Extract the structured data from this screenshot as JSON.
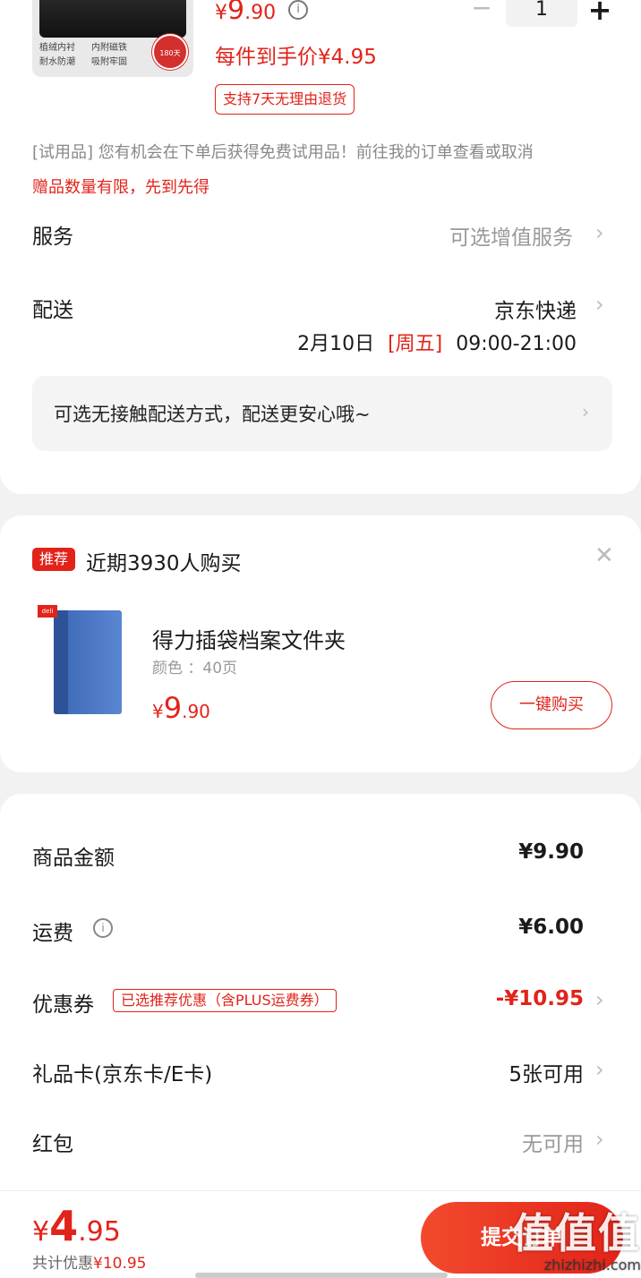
{
  "product": {
    "price_symbol": "¥",
    "price_int": "9",
    "price_dec": ".90",
    "tags": [
      "植绒内衬",
      "内附磁铁",
      "耐水防潮",
      "吸附牢固"
    ],
    "badge_text": "180天",
    "unit_price_text": "每件到手价¥4.95",
    "return_tag": "支持7天无理由退货",
    "quantity": "1",
    "qty_minus": "−",
    "qty_plus": "+"
  },
  "trial": {
    "text": "[试用品] 您有机会在下单后获得免费试用品！前往我的订单查看或取消",
    "limit": "赠品数量有限，先到先得"
  },
  "service": {
    "label": "服务",
    "value": "可选增值服务"
  },
  "delivery": {
    "label": "配送",
    "value": "京东快递",
    "date": "2月10日",
    "weekday": "[周五]",
    "time": "09:00-21:00"
  },
  "contactless": {
    "text": "可选无接触配送方式，配送更安心哦~"
  },
  "recommend": {
    "badge": "推荐",
    "title": "近期3930人购买",
    "product_name": "得力插袋档案文件夹",
    "spec": "颜色 ：40页",
    "price_symbol": "¥",
    "price_int": "9",
    "price_dec": ".90",
    "buy_label": "一键购买",
    "logo_text": "deli"
  },
  "summary": {
    "goods_label": "商品金额",
    "goods_value": "¥9.90",
    "shipping_label": "运费",
    "shipping_value": "¥6.00",
    "coupon_label": "优惠券",
    "coupon_tag": "已选推荐优惠（含PLUS运费券）",
    "coupon_value": "-¥10.95",
    "giftcard_label": "礼品卡(京东卡/E卡)",
    "giftcard_value": "5张可用",
    "redpacket_label": "红包",
    "redpacket_value": "无可用"
  },
  "bottom": {
    "total_symbol": "¥",
    "total_int": "4",
    "total_dec": ".95",
    "saved_label": "共计优惠",
    "saved_value": "¥10.95",
    "submit_label": "提交订单"
  },
  "watermark": {
    "big": "值值值",
    "small": "zhizhizhi.com"
  },
  "colors": {
    "accent": "#e2231a",
    "background": "#f2f2f2"
  }
}
